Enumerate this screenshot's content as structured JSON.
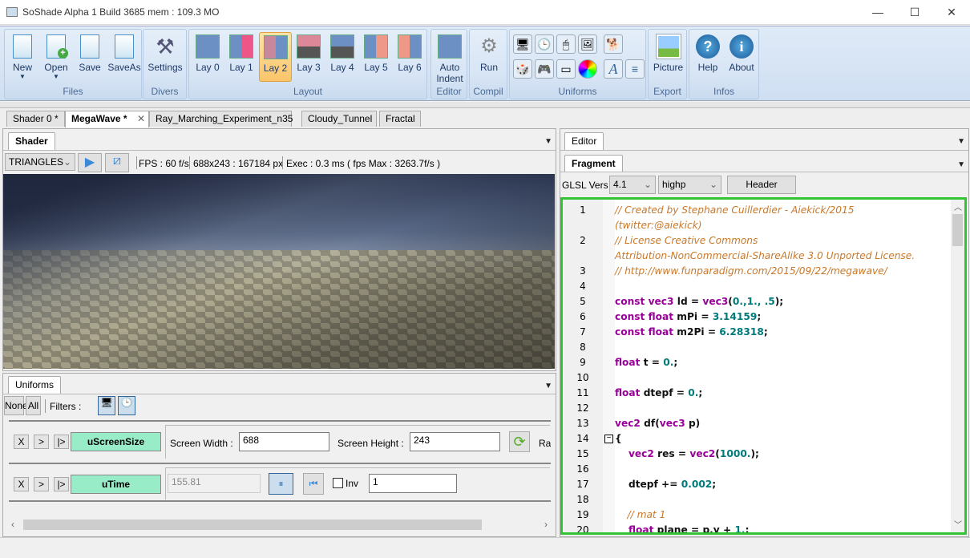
{
  "window": {
    "title": "SoShade Alpha 1 Build 3685 mem : 109.3 MO",
    "minimize": "—",
    "maximize": "☐",
    "close": "✕"
  },
  "ribbon": {
    "groups": [
      {
        "label": "Files"
      },
      {
        "label": "Divers"
      },
      {
        "label": "Layout"
      },
      {
        "label": "Editor"
      },
      {
        "label": "Compil"
      },
      {
        "label": "Uniforms"
      },
      {
        "label": "Export"
      },
      {
        "label": "Infos"
      }
    ],
    "files": {
      "new": "New",
      "open": "Open",
      "save": "Save",
      "saveas": "SaveAs"
    },
    "divers": {
      "settings": "Settings"
    },
    "layout": [
      "Lay 0",
      "Lay 1",
      "Lay 2",
      "Lay 3",
      "Lay 4",
      "Lay 5",
      "Lay 6"
    ],
    "active_layout": "Lay 2",
    "editor": {
      "auto_indent": "Auto Indent"
    },
    "compil": {
      "run": "Run"
    },
    "uniforms_icons": [
      "screen-icon",
      "clock-icon",
      "mouse-icon",
      "picture-icon",
      "dog-icon",
      "cube-icon",
      "gamepad-icon",
      "slider-icon",
      "color-wheel-icon",
      "font-icon",
      "layers-icon"
    ],
    "export": {
      "picture": "Picture"
    },
    "infos": {
      "help": "Help",
      "about": "About"
    }
  },
  "doc_tabs": [
    {
      "label": "Shader 0 *"
    },
    {
      "label": "MegaWave *",
      "active": true
    },
    {
      "label": "Ray_Marching_Experiment_n35"
    },
    {
      "label": "Cloudy_Tunnel"
    },
    {
      "label": "Fractal"
    }
  ],
  "shader_panel": {
    "tab": "Shader",
    "mode": "TRIANGLES",
    "fps": "FPS : 60 f/s",
    "size": "688x243 : 167184 px",
    "exec": "Exec : 0.3 ms ( fps Max : 3263.7f/s )"
  },
  "uniforms_panel": {
    "tab": "Uniforms",
    "none": "None",
    "all": "All",
    "filters": "Filters :",
    "rows": [
      {
        "x": "X",
        "step": ">",
        "play": "|>",
        "name": "uScreenSize",
        "width_label": "Screen Width :",
        "width": "688",
        "height_label": "Screen Height :",
        "height": "243",
        "extra": "Ra"
      },
      {
        "x": "X",
        "step": ">",
        "play": "|>",
        "name": "uTime",
        "value": "155.81",
        "inv_label": "Inv",
        "inv_checked": false,
        "speed": "1"
      }
    ]
  },
  "editor_panel": {
    "tab": "Editor",
    "subtab": "Fragment",
    "glsl_label": "GLSL Vers :",
    "glsl_version": "4.1",
    "precision": "highp",
    "header_button": "Header",
    "lines": [
      {
        "n": "1",
        "t": [
          [
            "// Created by Stephane Cuillerdier - Aiekick/2015",
            "c"
          ]
        ]
      },
      {
        "n": "",
        "t": [
          [
            "(twitter:@aiekick)",
            "c"
          ]
        ]
      },
      {
        "n": "2",
        "t": [
          [
            "// License Creative Commons",
            "c"
          ]
        ]
      },
      {
        "n": "",
        "t": [
          [
            "Attribution-NonCommercial-ShareAlike 3.0 Unported License.",
            "c"
          ]
        ]
      },
      {
        "n": "3",
        "t": [
          [
            "// http://www.funparadigm.com/2015/09/22/megawave/",
            "c"
          ]
        ]
      },
      {
        "n": "4",
        "t": []
      },
      {
        "n": "5",
        "t": [
          [
            "const vec3 ",
            "k"
          ],
          [
            "ld = ",
            "p"
          ],
          [
            "vec3",
            "k"
          ],
          [
            "(",
            "p"
          ],
          [
            "0.,1., .5",
            "n"
          ],
          [
            ");",
            "p"
          ]
        ]
      },
      {
        "n": "6",
        "t": [
          [
            "const float ",
            "k"
          ],
          [
            "mPi = ",
            "p"
          ],
          [
            "3.14159",
            "n"
          ],
          [
            ";",
            "p"
          ]
        ]
      },
      {
        "n": "7",
        "t": [
          [
            "const float ",
            "k"
          ],
          [
            "m2Pi = ",
            "p"
          ],
          [
            "6.28318",
            "n"
          ],
          [
            ";",
            "p"
          ]
        ]
      },
      {
        "n": "8",
        "t": []
      },
      {
        "n": "9",
        "t": [
          [
            "float ",
            "k"
          ],
          [
            "t = ",
            "p"
          ],
          [
            "0.",
            "n"
          ],
          [
            ";",
            "p"
          ]
        ]
      },
      {
        "n": "10",
        "t": []
      },
      {
        "n": "11",
        "t": [
          [
            "float ",
            "k"
          ],
          [
            "dtepf = ",
            "p"
          ],
          [
            "0.",
            "n"
          ],
          [
            ";",
            "p"
          ]
        ]
      },
      {
        "n": "12",
        "t": []
      },
      {
        "n": "13",
        "t": [
          [
            "vec2 ",
            "k"
          ],
          [
            "df(",
            "p"
          ],
          [
            "vec3 ",
            "k"
          ],
          [
            "p)",
            "p"
          ]
        ]
      },
      {
        "n": "14",
        "t": [
          [
            "{",
            "p"
          ]
        ],
        "fold": true
      },
      {
        "n": "15",
        "t": [
          [
            "    vec2 ",
            "k"
          ],
          [
            "res = ",
            "p"
          ],
          [
            "vec2",
            "k"
          ],
          [
            "(",
            "p"
          ],
          [
            "1000.",
            "n"
          ],
          [
            ");",
            "p"
          ]
        ]
      },
      {
        "n": "16",
        "t": []
      },
      {
        "n": "17",
        "t": [
          [
            "    dtepf += ",
            "p"
          ],
          [
            "0.002",
            "n"
          ],
          [
            ";",
            "p"
          ]
        ]
      },
      {
        "n": "18",
        "t": []
      },
      {
        "n": "19",
        "t": [
          [
            "    // mat 1",
            "c"
          ]
        ]
      },
      {
        "n": "20",
        "t": [
          [
            "    float ",
            "k"
          ],
          [
            "plane = p.y + ",
            "p"
          ],
          [
            "1.",
            "n"
          ],
          [
            ";",
            "p"
          ]
        ]
      }
    ]
  },
  "colors": {
    "accent_border": "#33c433",
    "uniform_name_bg": "#98ecc8",
    "ribbon_bg": "#d6e4f4",
    "active_layout": "#fbc56a"
  }
}
